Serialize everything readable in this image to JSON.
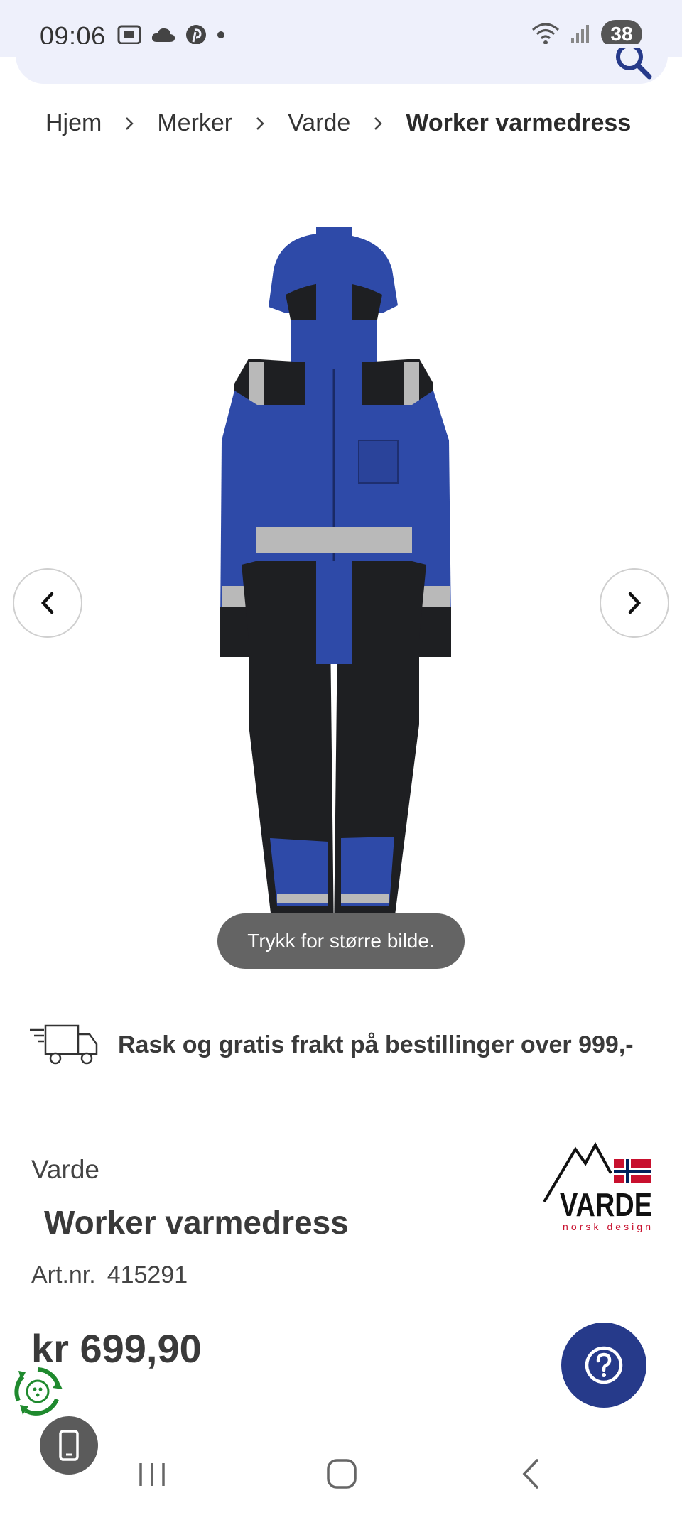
{
  "status_bar": {
    "time": "09:06",
    "battery": "38",
    "icons_left": [
      "screenshot-icon",
      "cloud-icon",
      "pinterest-icon",
      "dot-icon"
    ],
    "icons_right": [
      "wifi-icon",
      "signal-icon",
      "battery-icon"
    ]
  },
  "search": {
    "icon": "search-icon"
  },
  "breadcrumb": {
    "items": [
      "Hjem",
      "Merker",
      "Varde"
    ],
    "current": "Worker varmedress"
  },
  "gallery": {
    "prev_icon": "chevron-left-icon",
    "next_icon": "chevron-right-icon",
    "tooltip": "Trykk for større bilde.",
    "colors": {
      "blue": "#2e4aa8",
      "black": "#1e1f22",
      "reflective": "#b9b9b9"
    }
  },
  "shipping": {
    "icon": "delivery-truck-icon",
    "text": "Rask og gratis frakt på bestillinger over 999,-"
  },
  "product": {
    "brand": "Varde",
    "title": "Worker varmedress",
    "artnr_label": "Art.nr.",
    "artnr": "415291",
    "price": "kr 699,90"
  },
  "brand_logo": {
    "name": "VARDE",
    "tagline": "norsk design"
  },
  "help": {
    "icon": "question-mark-icon",
    "color": "#263a8a"
  },
  "floating": {
    "recycle_icon": "recycle-badge-icon",
    "phone_icon": "phone-icon"
  },
  "system_nav": {
    "icons": [
      "recent-apps-icon",
      "home-icon",
      "back-icon"
    ]
  }
}
